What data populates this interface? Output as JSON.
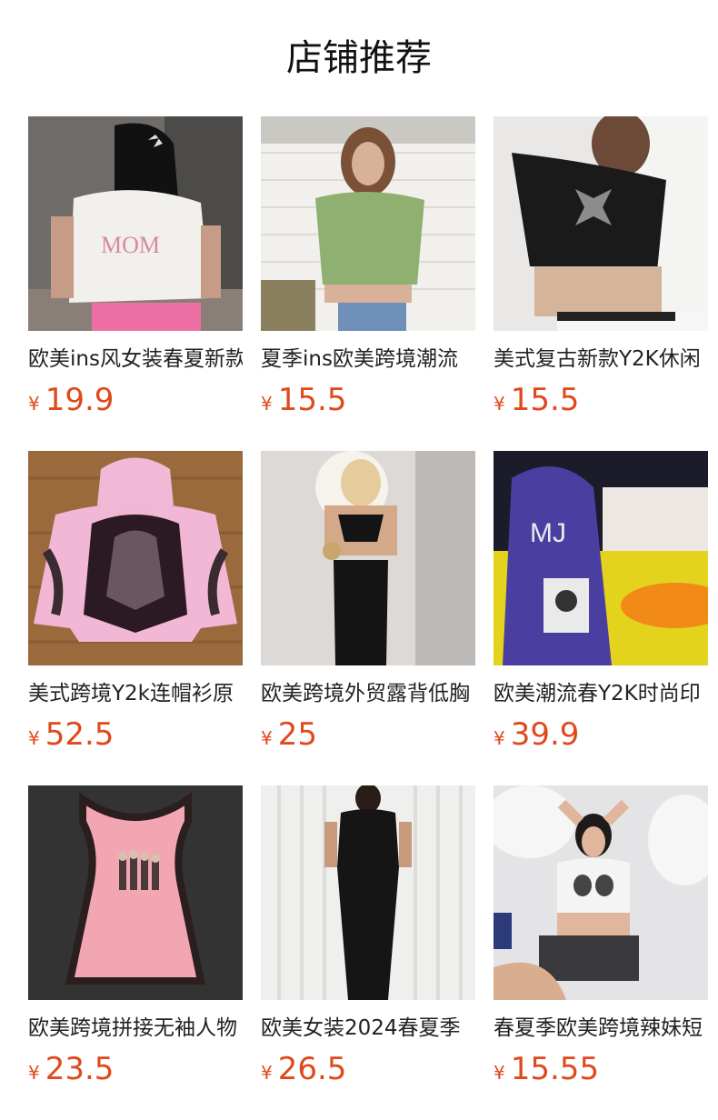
{
  "section": {
    "title": "店铺推荐"
  },
  "products": [
    {
      "name": "欧美ins风女装春夏新款",
      "currency": "¥",
      "price": "19.9"
    },
    {
      "name": "夏季ins欧美跨境潮流",
      "currency": "¥",
      "price": "15.5"
    },
    {
      "name": "美式复古新款Y2K休闲",
      "currency": "¥",
      "price": "15.5"
    },
    {
      "name": "美式跨境Y2k连帽衫原",
      "currency": "¥",
      "price": "52.5"
    },
    {
      "name": "欧美跨境外贸露背低胸",
      "currency": "¥",
      "price": "25"
    },
    {
      "name": "欧美潮流春Y2K时尚印",
      "currency": "¥",
      "price": "39.9"
    },
    {
      "name": "欧美跨境拼接无袖人物",
      "currency": "¥",
      "price": "23.5"
    },
    {
      "name": "欧美女装2024春夏季",
      "currency": "¥",
      "price": "26.5"
    },
    {
      "name": "春夏季欧美跨境辣妹短",
      "currency": "¥",
      "price": "15.55"
    }
  ],
  "colors": {
    "price": "#e0491b",
    "title": "#111111",
    "name": "#222222"
  }
}
